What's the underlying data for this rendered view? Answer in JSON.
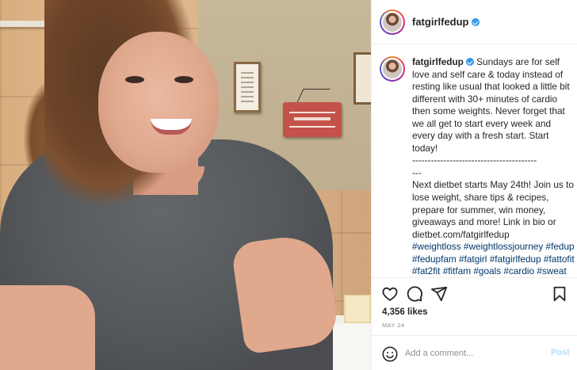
{
  "post": {
    "username": "fatgirlfedup",
    "verified": true,
    "caption_text": "Sundays are for self love and self care & today instead of resting like usual that looked a little bit different with 30+ minutes of cardio then some weights. Never forget that we all get to start every week and every day with a fresh start. Start today!\n----------------------------------------\n---\nNext dietbet starts May 24th! Join us to lose weight, share tips & recipes, prepare for summer, win money, giveaways and more! Link in bio or dietbet.com/fatgirlfedup",
    "hashtags": "#weightloss #weightlossjourney #fedup #fedupfam #fatgirl #fatgirlfedup #fattofit #fat2fit #fitfam #goals #cardio #sweat #losingweight #countingcalories #gym #workout",
    "likes": "4,356 likes",
    "date": "MAY 24"
  },
  "icons": {
    "like": "heart-icon",
    "comment": "comment-icon",
    "share": "share-icon",
    "save": "bookmark-icon",
    "emoji": "emoji-icon"
  },
  "comment_box": {
    "placeholder": "Add a comment...",
    "post_label": "Post"
  },
  "colors": {
    "verified_badge": "#3897f0",
    "hashtag": "#00376b",
    "post_button_disabled": "#b2dffc",
    "meta_text": "#8e8e8e"
  }
}
